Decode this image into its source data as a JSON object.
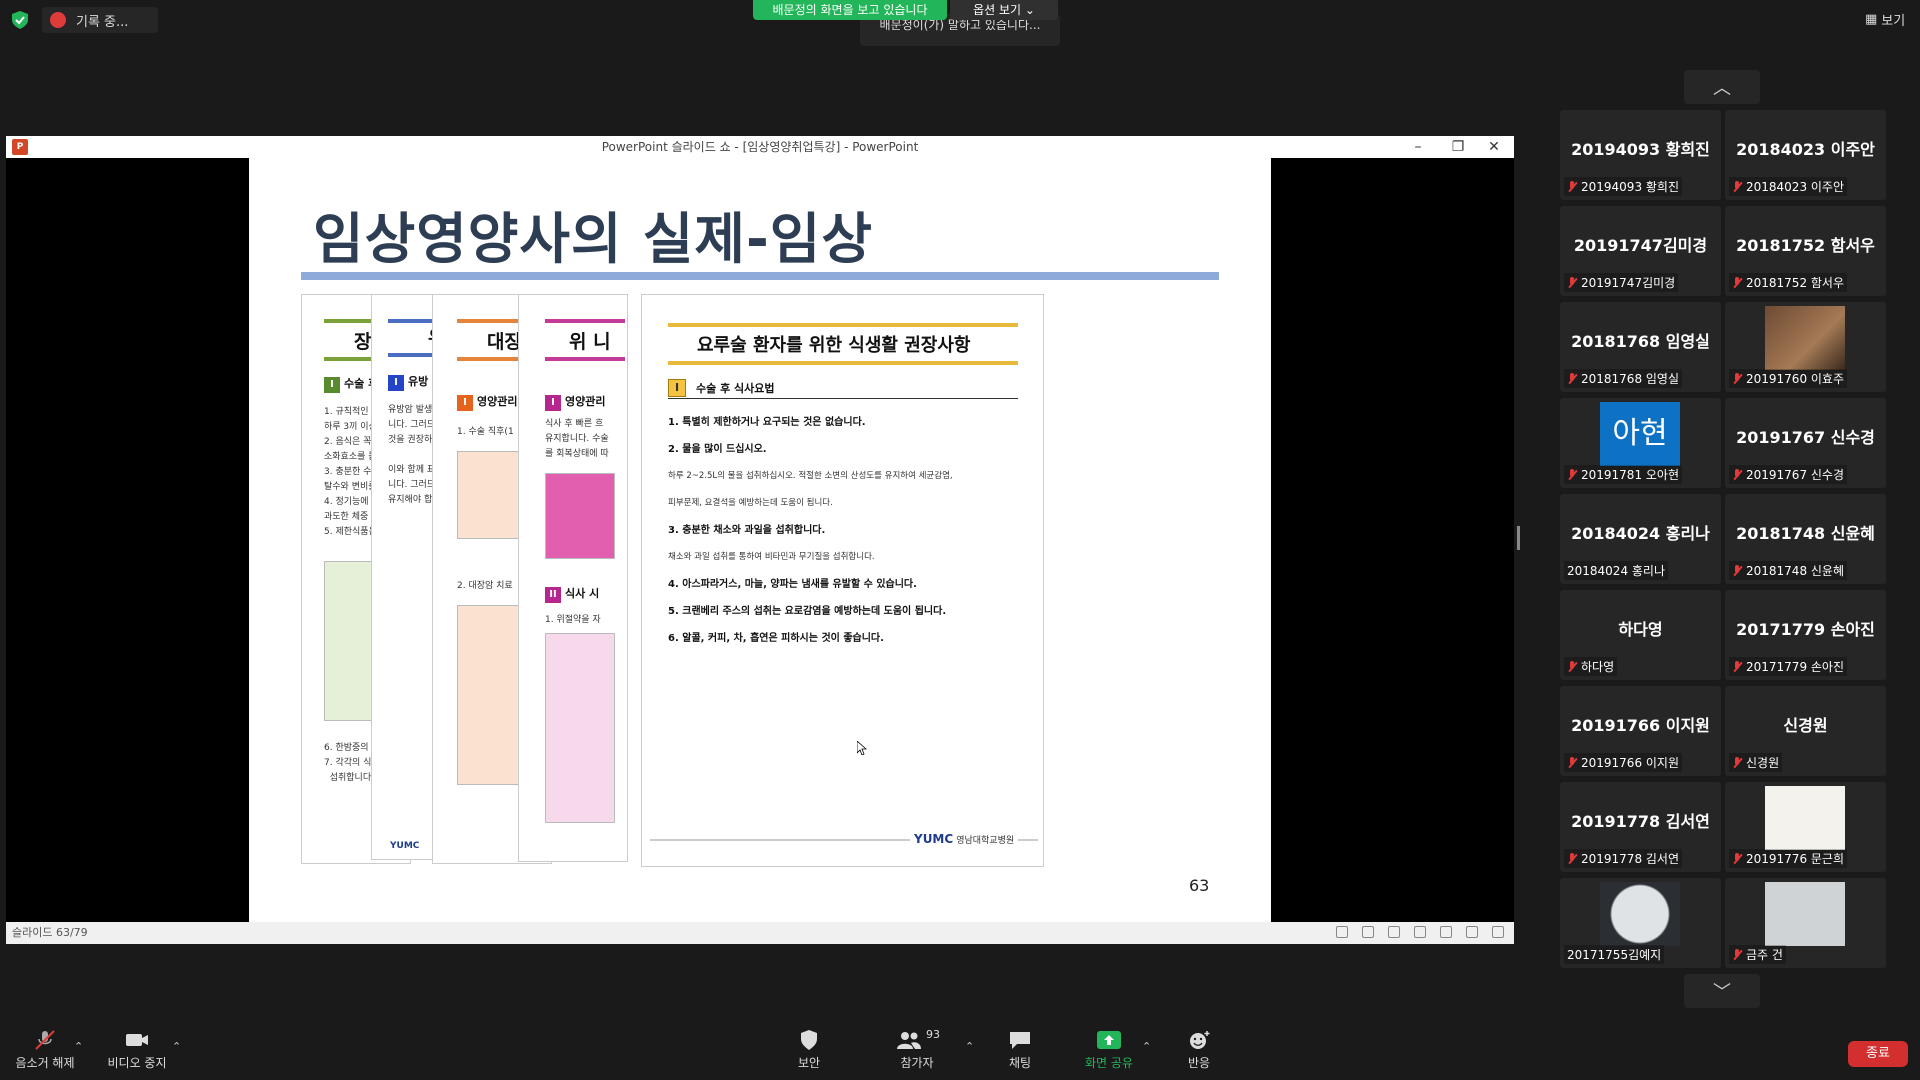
{
  "topbar": {
    "recording_label": "기록 중...",
    "share_indicator": "배문정의 화면을 보고 있습니다",
    "options_label": "옵션 보기 ⌄",
    "speaking_text": "배문정이(가) 말하고 있습니다...",
    "view_label": "보기"
  },
  "ppt": {
    "window_title": "PowerPoint 슬라이드 쇼 - [임상영양취업특강] - PowerPoint",
    "slide_title": "임상영양사의 실제-임상",
    "slide_number": "63",
    "status": "슬라이드 63/79",
    "back_docs": [
      "장루",
      "유",
      "대장",
      "위 니"
    ],
    "back_secs": [
      "수술 후",
      "유방",
      "영양관리",
      "영양관리",
      "식사 시"
    ],
    "main_doc": {
      "title": "요루술 환자를 위한 식생활 권장사항",
      "section_no": "I",
      "section": "수술 후 식사요법",
      "items": [
        "1. 특별히 제한하거나 요구되는 것은 없습니다.",
        "2. 물을 많이 드십시오.",
        "하루 2~2.5L의 물을 섭취하십시오. 적절한 소변의 산성도를 유지하여 세균감염,",
        "피부문제, 요결석을 예방하는데 도움이 됩니다.",
        "3. 충분한 채소와 과일을 섭취합니다.",
        "채소와 과일 섭취를 통하여 비타민과 무기질을 섭취합니다.",
        "4. 아스파라거스, 마늘, 양파는 냄새를 유발할 수 있습니다.",
        "5. 크랜베리 주스의 섭취는 요로감염을 예방하는데 도움이 됩니다.",
        "6. 알콜, 커피, 차, 흡연은 피하시는 것이 좋습니다."
      ],
      "logo": "YUMC",
      "logo_sub": "영남대학교병원"
    }
  },
  "gallery": {
    "participants": [
      {
        "big": "20194093 황희진",
        "small": "20194093 황희진",
        "muted": true
      },
      {
        "big": "20184023 이주안",
        "small": "20184023 이주안",
        "muted": true
      },
      {
        "big": "20191747김미경",
        "small": "20191747김미경",
        "muted": true
      },
      {
        "big": "20181752 함서우",
        "small": "20181752 함서우",
        "muted": true
      },
      {
        "big": "20181768 임영실",
        "small": "20181768 임영실",
        "muted": true
      },
      {
        "big": "",
        "small": "20191760 이효주",
        "muted": true,
        "avatar": "dog"
      },
      {
        "big": "",
        "small": "20191781 오아현",
        "muted": true,
        "avatar": "text",
        "avatar_text": "아현"
      },
      {
        "big": "20191767 신수경",
        "small": "20191767 신수경",
        "muted": true
      },
      {
        "big": "20184024 홍리나",
        "small": "20184024 홍리나",
        "muted": false
      },
      {
        "big": "20181748 신윤혜",
        "small": "20181748 신윤혜",
        "muted": true
      },
      {
        "big": "하다영",
        "small": "하다영",
        "muted": true
      },
      {
        "big": "20171779 손아진",
        "small": "20171779 손아진",
        "muted": true
      },
      {
        "big": "20191766 이지원",
        "small": "20191766 이지원",
        "muted": true
      },
      {
        "big": "신경원",
        "small": "신경원",
        "muted": true
      },
      {
        "big": "20191778 김서연",
        "small": "20191778 김서연",
        "muted": true
      },
      {
        "big": "",
        "small": "20191776 문근희",
        "muted": true,
        "avatar": "white"
      },
      {
        "big": "",
        "small": "20171755김예지",
        "muted": false,
        "avatar": "moon"
      },
      {
        "big": "",
        "small": "금주 건",
        "muted": true,
        "avatar": "person"
      }
    ]
  },
  "toolbar": {
    "unmute": "음소거 해제",
    "video": "비디오 중지",
    "security": "보안",
    "participants": "참가자",
    "participants_count": "93",
    "chat": "채팅",
    "share": "화면 공유",
    "reactions": "반응",
    "end": "종료"
  },
  "colors": {
    "share_green": "#23b559",
    "end_red": "#d32f2f",
    "tile_bg": "#262626"
  }
}
